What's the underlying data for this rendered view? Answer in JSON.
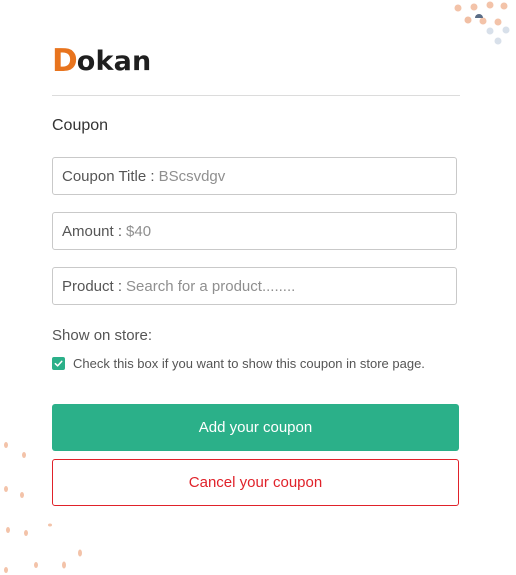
{
  "brand": {
    "logo_first_letter": "D",
    "logo_rest": "okan",
    "accent_color": "#e8741e"
  },
  "form": {
    "section_title": "Coupon",
    "fields": [
      {
        "label": "Coupon Title :",
        "value": "BScsvdgv"
      },
      {
        "label": "Amount :",
        "value": "$40"
      },
      {
        "label": "Product :",
        "value": "Search for a product........"
      }
    ],
    "show_on_store_label": "Show on store:",
    "checkbox_text": "Check this box if you want to show this coupon in store page.",
    "checkbox_checked": true,
    "add_button_label": "Add your coupon",
    "cancel_button_label": "Cancel your coupon",
    "primary_color": "#2bb089",
    "danger_color": "#e0222a"
  }
}
